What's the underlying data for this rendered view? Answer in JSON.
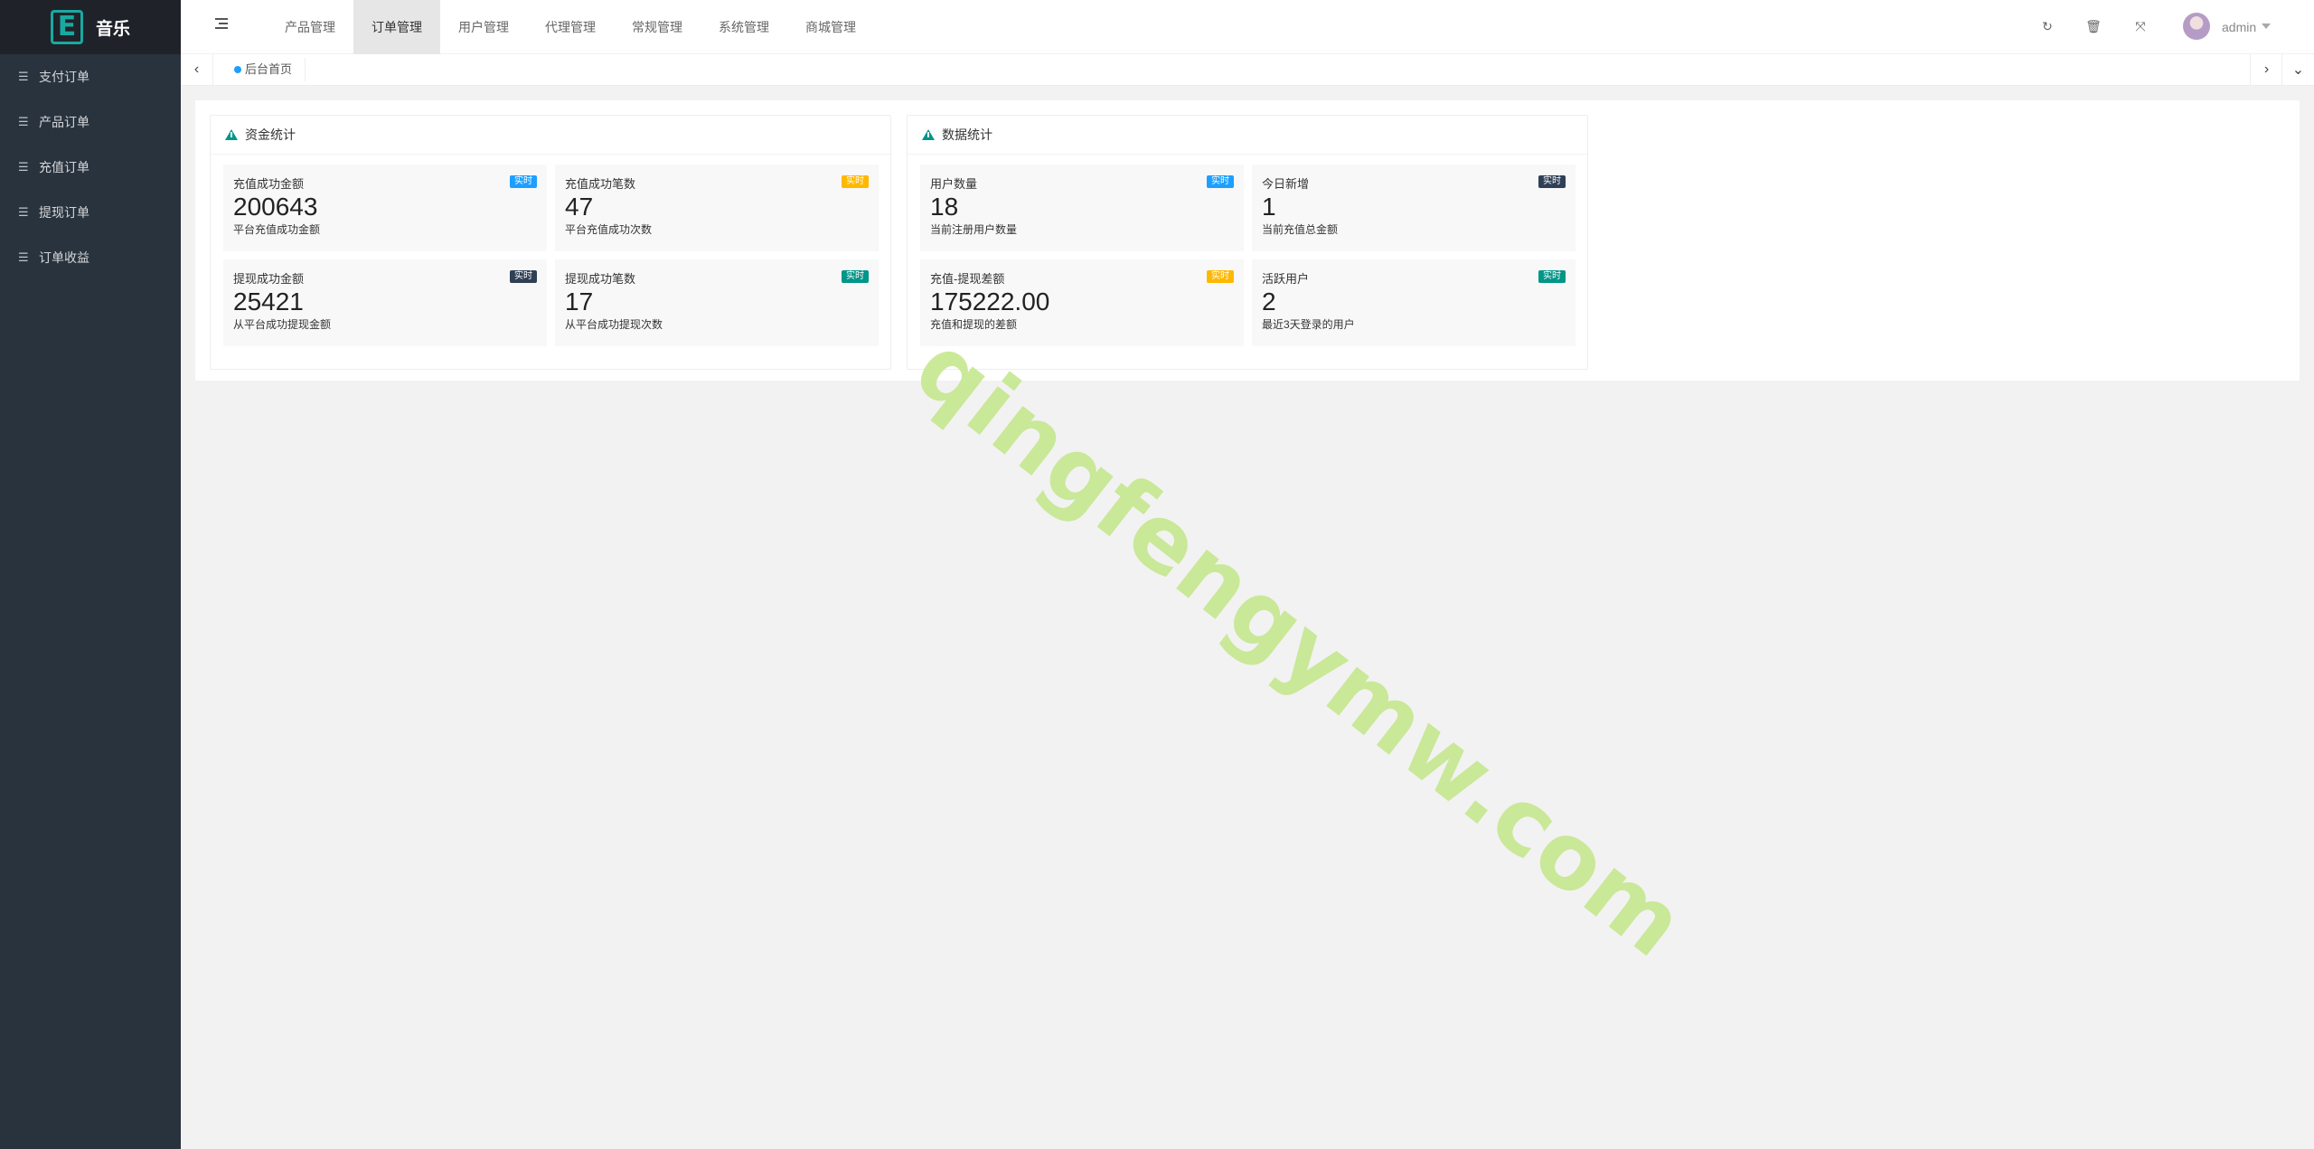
{
  "app": {
    "logo_letter": "E",
    "name": "音乐"
  },
  "sidebar": {
    "items": [
      {
        "label": "支付订单",
        "icon": "list-icon"
      },
      {
        "label": "产品订单",
        "icon": "list-icon"
      },
      {
        "label": "充值订单",
        "icon": "list-icon"
      },
      {
        "label": "提现订单",
        "icon": "list-icon"
      },
      {
        "label": "订单收益",
        "icon": "list-icon"
      }
    ]
  },
  "header": {
    "nav": [
      {
        "label": "产品管理",
        "active": false
      },
      {
        "label": "订单管理",
        "active": true
      },
      {
        "label": "用户管理",
        "active": false
      },
      {
        "label": "代理管理",
        "active": false
      },
      {
        "label": "常规管理",
        "active": false
      },
      {
        "label": "系统管理",
        "active": false
      },
      {
        "label": "商城管理",
        "active": false
      }
    ],
    "icons": [
      "refresh-icon",
      "clear-cache-icon",
      "fullscreen-icon",
      "more-icon"
    ],
    "user": "admin"
  },
  "tabs": {
    "home": "后台首页"
  },
  "panels": {
    "funds": {
      "title": "资金统计",
      "cards": [
        {
          "label": "充值成功金额",
          "value": "200643",
          "desc": "平台充值成功金额",
          "badge": "实时",
          "badge_color": "#1e9fff"
        },
        {
          "label": "充值成功笔数",
          "value": "47",
          "desc": "平台充值成功次数",
          "badge": "实时",
          "badge_color": "#ffb800"
        },
        {
          "label": "提现成功金额",
          "value": "25421",
          "desc": "从平台成功提现金额",
          "badge": "实时",
          "badge_color": "#2f4056"
        },
        {
          "label": "提现成功笔数",
          "value": "17",
          "desc": "从平台成功提现次数",
          "badge": "实时",
          "badge_color": "#009688"
        }
      ]
    },
    "data": {
      "title": "数据统计",
      "cards": [
        {
          "label": "用户数量",
          "value": "18",
          "desc": "当前注册用户数量",
          "badge": "实时",
          "badge_color": "#1e9fff"
        },
        {
          "label": "今日新增",
          "value": "1",
          "desc": "当前充值总金额",
          "badge": "实时",
          "badge_color": "#2f4056"
        },
        {
          "label": "充值-提现差额",
          "value": "175222.00",
          "desc": "充值和提现的差额",
          "badge": "实时",
          "badge_color": "#ffb800"
        },
        {
          "label": "活跃用户",
          "value": "2",
          "desc": "最近3天登录的用户",
          "badge": "实时",
          "badge_color": "#009688"
        }
      ]
    }
  },
  "watermark": "qingfengymw.com",
  "colors": {
    "sidebar": "#28333e",
    "logo_bg": "#20222a",
    "accent": "#009688",
    "blue": "#1e9fff"
  }
}
